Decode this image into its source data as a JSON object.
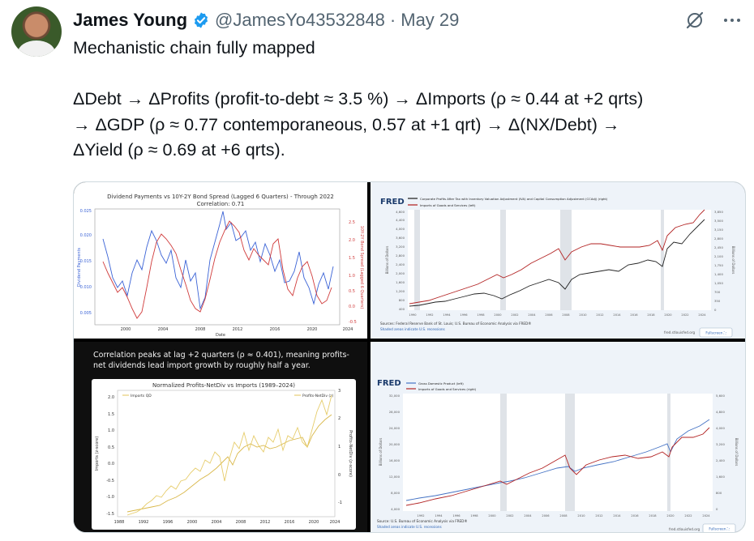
{
  "tweet": {
    "author_name": "James Young",
    "handle": "@JamesYo43532848",
    "separator": "·",
    "date": "May 29",
    "text": "Mechanistic chain fully mapped\n\nΔDebt → ΔProfits (profit-to-debt ≈ 3.5 %) → ΔImports (ρ ≈ 0.44 at +2 qrts)\n→ ΔGDP (ρ ≈ 0.77 contemporaneous, 0.57 at +1 qrt) → Δ(NX/Debt) →\nΔYield (ρ ≈ 0.69 at +6 qrts)."
  },
  "icons": {
    "verified": "verified-badge-icon",
    "grok": "grok-icon",
    "more": "more-icon"
  },
  "colors": {
    "verified": "#1d9bf0",
    "blue_line": "#3b63d6",
    "red_line": "#d03b3b",
    "gold_line": "#e3c35a",
    "fred_blue": "#4472c4",
    "fred_red": "#b22222",
    "fred_black": "#222222"
  },
  "media": {
    "chart1": {
      "title": "Dividend Payments vs 10Y-2Y Bond Spread (Lagged 6 Quarters) - Through 2022",
      "subtitle": "Correlation: 0.71",
      "ylabel_left": "Dividend Payments",
      "ylabel_right": "10Y-2Y Bond Spread (Lagged 6 Quarters)",
      "xlabel": "Date",
      "y_left_ticks": [
        "0.025",
        "0.020",
        "0.015",
        "0.010",
        "0.005"
      ],
      "y_right_ticks": [
        "2.5",
        "2.0",
        "1.5",
        "1.0",
        "0.5",
        "0.0",
        "-0.5"
      ],
      "x_ticks": [
        "2000",
        "2004",
        "2008",
        "2012",
        "2016",
        "2020",
        "2024"
      ]
    },
    "chart2": {
      "logo": "FRED",
      "legend": [
        "Corporate Profits After Tax with Inventory Valuation Adjustment (IVA) and Capital Consumption Adjustment (CCAdj) (right)",
        "Imports of Goods and Services (left)"
      ],
      "ylabel_left": "Billions of Dollars",
      "ylabel_right": "Billions of Dollars",
      "y_left_ticks": [
        "4,600",
        "4,400",
        "4,000",
        "3,600",
        "3,200",
        "2,800",
        "2,400",
        "2,000",
        "1,600",
        "1,200",
        "800",
        "400"
      ],
      "y_right_ticks": [
        "3,850",
        "3,500",
        "3,150",
        "2,800",
        "2,450",
        "2,100",
        "1,750",
        "1,400",
        "1,050",
        "700",
        "350",
        "0"
      ],
      "x_ticks": [
        "1990",
        "1992",
        "1994",
        "1996",
        "1998",
        "2000",
        "2002",
        "2004",
        "2006",
        "2008",
        "2010",
        "2012",
        "2014",
        "2016",
        "2018",
        "2020",
        "2022",
        "2024"
      ],
      "source": "Sources: Federal Reserve Bank of St. Louis; U.S. Bureau of Economic Analysis via FRED®",
      "shaded": "Shaded areas indicate U.S. recessions",
      "site": "fred.stlouisfed.org",
      "fullscreen": "Fullscreen ⛶"
    },
    "chart3": {
      "caption": "Correlation peaks at lag +2 quarters (ρ ≈ 0.401), meaning profits-net dividends lead import growth by roughly half a year.",
      "title": "Normalized Profits-NetDiv vs Imports (1989–2024)",
      "legend_left": "Imports QD",
      "legend_right": "Profits-NetDiv (z)",
      "ylabel_left": "Imports (z-score)",
      "ylabel_right": "Profits-NetDiv (z-score)",
      "y_left_ticks": [
        "2.0",
        "1.5",
        "1.0",
        "0.5",
        "0.0",
        "-0.5",
        "-1.0",
        "-1.5"
      ],
      "y_right_ticks": [
        "3",
        "2",
        "1",
        "0",
        "-1"
      ],
      "x_ticks": [
        "1988",
        "1992",
        "1996",
        "2000",
        "2004",
        "2008",
        "2012",
        "2016",
        "2020",
        "2024"
      ]
    },
    "chart4": {
      "logo": "FRED",
      "legend": [
        "Gross Domestic Product (left)",
        "Imports of Goods and Services (right)"
      ],
      "ylabel_left": "Billions of Dollars",
      "ylabel_right": "Billions of Dollars",
      "y_left_ticks": [
        "32,000",
        "28,000",
        "24,000",
        "20,000",
        "16,000",
        "12,000",
        "8,000",
        "4,000"
      ],
      "y_right_ticks": [
        "5,600",
        "4,800",
        "4,000",
        "3,200",
        "2,400",
        "1,600",
        "800",
        "0"
      ],
      "x_ticks": [
        "1992",
        "1994",
        "1996",
        "1998",
        "2000",
        "2002",
        "2004",
        "2006",
        "2008",
        "2010",
        "2012",
        "2014",
        "2016",
        "2018",
        "2020",
        "2022",
        "2024"
      ],
      "source": "Source: U.S. Bureau of Economic Analysis via FRED®",
      "shaded": "Shaded areas indicate U.S. recessions",
      "site": "fred.stlouisfed.org",
      "fullscreen": "Fullscreen ⛶"
    }
  }
}
